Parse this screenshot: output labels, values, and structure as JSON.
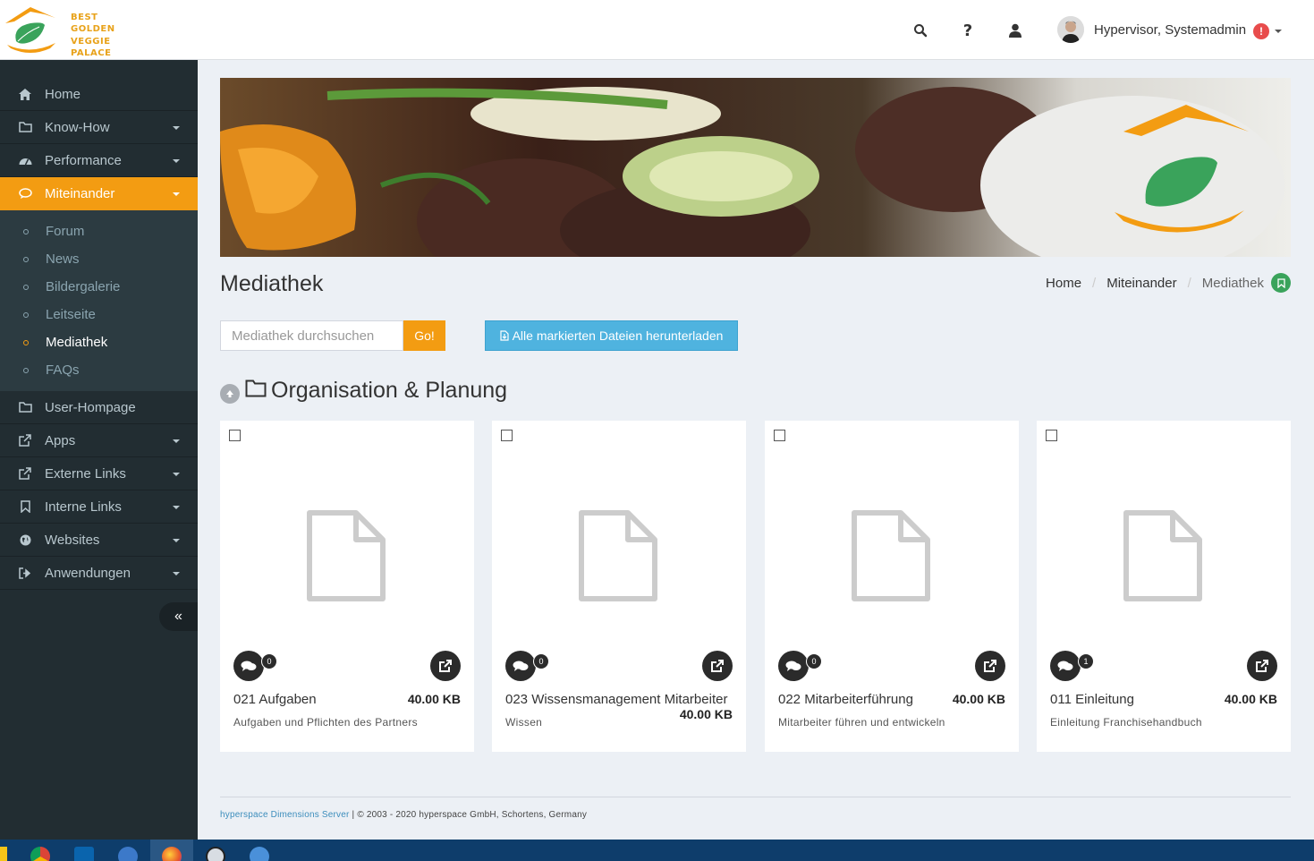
{
  "brand": {
    "logo_lines": [
      "BEST",
      "GOLDEN",
      "VEGGIE",
      "PALACE"
    ],
    "accent": "#f39c12"
  },
  "header": {
    "icons": [
      "search-icon",
      "help-icon",
      "user-icon"
    ],
    "user_name": "Hypervisor, Systemadmin",
    "alert_badge": "!"
  },
  "sidebar": {
    "items": [
      {
        "label": "Home",
        "icon": "home-icon",
        "has_caret": false
      },
      {
        "label": "Know-How",
        "icon": "folder-icon",
        "has_caret": true
      },
      {
        "label": "Performance",
        "icon": "dashboard-icon",
        "has_caret": true
      },
      {
        "label": "Miteinander",
        "icon": "chat-icon",
        "has_caret": true,
        "active": true
      }
    ],
    "submenu": [
      {
        "label": "Forum"
      },
      {
        "label": "News"
      },
      {
        "label": "Bildergalerie"
      },
      {
        "label": "Leitseite"
      },
      {
        "label": "Mediathek",
        "current": true
      },
      {
        "label": "FAQs"
      }
    ],
    "items_after": [
      {
        "label": "User-Hompage",
        "icon": "folder-icon",
        "has_caret": false
      },
      {
        "label": "Apps",
        "icon": "external-link-icon",
        "has_caret": true
      },
      {
        "label": "Externe Links",
        "icon": "external-link-icon",
        "has_caret": true
      },
      {
        "label": "Interne Links",
        "icon": "bookmark-icon",
        "has_caret": true
      },
      {
        "label": "Websites",
        "icon": "globe-icon",
        "has_caret": true
      },
      {
        "label": "Anwendungen",
        "icon": "sign-out-icon",
        "has_caret": true
      }
    ],
    "collapse_label": "«"
  },
  "page": {
    "title": "Mediathek",
    "breadcrumb": [
      "Home",
      "Miteinander",
      "Mediathek"
    ],
    "search_placeholder": "Mediathek durchsuchen",
    "go_label": "Go!",
    "download_label": "Alle markierten Dateien herunterladen",
    "folder_title": "Organisation & Planung"
  },
  "files": [
    {
      "name": "021 Aufgaben",
      "size": "40.00 KB",
      "description": "Aufgaben und Pflichten des Partners",
      "comments": "0"
    },
    {
      "name": "023 Wissensmanagement Mitarbeiter",
      "size": "40.00 KB",
      "description": "Wissen",
      "comments": "0"
    },
    {
      "name": "022 Mitarbeiterführung",
      "size": "40.00 KB",
      "description": "Mitarbeiter führen und entwickeln",
      "comments": "0"
    },
    {
      "name": "011 Einleitung",
      "size": "40.00 KB",
      "description": "Einleitung Franchisehandbuch",
      "comments": "1"
    }
  ],
  "footer": {
    "link": "hyperspace Dimensions Server",
    "text": " | © 2003 - 2020 hyperspace GmbH, Schortens, Germany"
  }
}
